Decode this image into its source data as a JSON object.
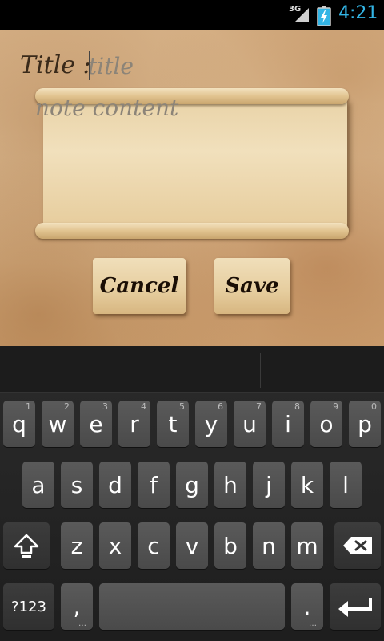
{
  "status_bar": {
    "network_type": "3G",
    "time": "4:21",
    "clock_color": "#33b5e5"
  },
  "editor": {
    "title_label": "Title :",
    "title_placeholder": "title",
    "title_value": "",
    "content_placeholder": "note content",
    "content_value": ""
  },
  "actions": {
    "cancel_label": "Cancel",
    "save_label": "Save"
  },
  "keyboard": {
    "row1": [
      {
        "label": "q",
        "hint": "1"
      },
      {
        "label": "w",
        "hint": "2"
      },
      {
        "label": "e",
        "hint": "3"
      },
      {
        "label": "r",
        "hint": "4"
      },
      {
        "label": "t",
        "hint": "5"
      },
      {
        "label": "y",
        "hint": "6"
      },
      {
        "label": "u",
        "hint": "7"
      },
      {
        "label": "i",
        "hint": "8"
      },
      {
        "label": "o",
        "hint": "9"
      },
      {
        "label": "p",
        "hint": "0"
      }
    ],
    "row2": [
      "a",
      "s",
      "d",
      "f",
      "g",
      "h",
      "j",
      "k",
      "l"
    ],
    "row3": [
      "z",
      "x",
      "c",
      "v",
      "b",
      "n",
      "m"
    ],
    "symbols_label": "?123",
    "comma_label": ",",
    "period_label": ".",
    "icons": {
      "shift": "shift-icon",
      "backspace": "backspace-icon",
      "enter": "enter-icon"
    }
  }
}
